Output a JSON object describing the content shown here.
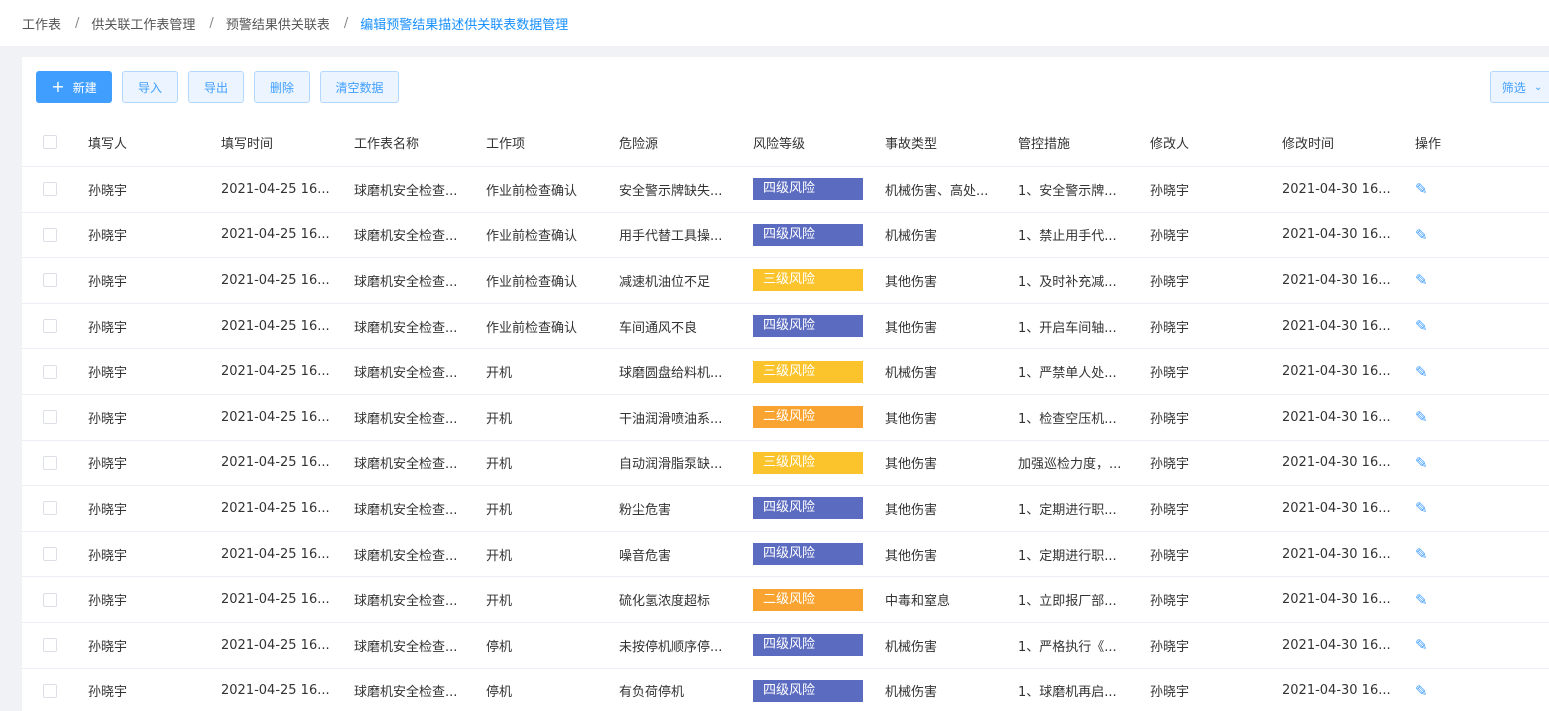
{
  "breadcrumb": [
    "工作表",
    "供关联工作表管理",
    "预警结果供关联表",
    "编辑预警结果描述供关联表数据管理"
  ],
  "toolbar": {
    "new_label": "新建",
    "import_label": "导入",
    "export_label": "导出",
    "delete_label": "删除",
    "clear_label": "清空数据",
    "filter_label": "筛选"
  },
  "columns": [
    "填写人",
    "填写时间",
    "工作表名称",
    "工作项",
    "危险源",
    "风险等级",
    "事故类型",
    "管控措施",
    "修改人",
    "修改时间",
    "操作"
  ],
  "risk_colors": {
    "四级风险": "#5b6bc0",
    "三级风险": "#fbc42d",
    "二级风险": "#f9a431"
  },
  "rows": [
    {
      "filler": "孙晓宇",
      "fill_time": "2021-04-25 16...",
      "sheet": "球磨机安全检查...",
      "item": "作业前检查确认",
      "hazard": "安全警示牌缺失...",
      "level": "四级风险",
      "type": "机械伤害、高处...",
      "control": "1、安全警示牌...",
      "modifier": "孙晓宇",
      "mod_time": "2021-04-30 16..."
    },
    {
      "filler": "孙晓宇",
      "fill_time": "2021-04-25 16...",
      "sheet": "球磨机安全检查...",
      "item": "作业前检查确认",
      "hazard": "用手代替工具操...",
      "level": "四级风险",
      "type": "机械伤害",
      "control": "1、禁止用手代...",
      "modifier": "孙晓宇",
      "mod_time": "2021-04-30 16..."
    },
    {
      "filler": "孙晓宇",
      "fill_time": "2021-04-25 16...",
      "sheet": "球磨机安全检查...",
      "item": "作业前检查确认",
      "hazard": "减速机油位不足",
      "level": "三级风险",
      "type": "其他伤害",
      "control": "1、及时补充减...",
      "modifier": "孙晓宇",
      "mod_time": "2021-04-30 16..."
    },
    {
      "filler": "孙晓宇",
      "fill_time": "2021-04-25 16...",
      "sheet": "球磨机安全检查...",
      "item": "作业前检查确认",
      "hazard": "车间通风不良",
      "level": "四级风险",
      "type": "其他伤害",
      "control": "1、开启车间轴...",
      "modifier": "孙晓宇",
      "mod_time": "2021-04-30 16..."
    },
    {
      "filler": "孙晓宇",
      "fill_time": "2021-04-25 16...",
      "sheet": "球磨机安全检查...",
      "item": "开机",
      "hazard": "球磨圆盘给料机...",
      "level": "三级风险",
      "type": "机械伤害",
      "control": "1、严禁单人处...",
      "modifier": "孙晓宇",
      "mod_time": "2021-04-30 16..."
    },
    {
      "filler": "孙晓宇",
      "fill_time": "2021-04-25 16...",
      "sheet": "球磨机安全检查...",
      "item": "开机",
      "hazard": "干油润滑喷油系...",
      "level": "二级风险",
      "type": "其他伤害",
      "control": "1、检查空压机...",
      "modifier": "孙晓宇",
      "mod_time": "2021-04-30 16..."
    },
    {
      "filler": "孙晓宇",
      "fill_time": "2021-04-25 16...",
      "sheet": "球磨机安全检查...",
      "item": "开机",
      "hazard": "自动润滑脂泵缺...",
      "level": "三级风险",
      "type": "其他伤害",
      "control": "加强巡检力度，...",
      "modifier": "孙晓宇",
      "mod_time": "2021-04-30 16..."
    },
    {
      "filler": "孙晓宇",
      "fill_time": "2021-04-25 16...",
      "sheet": "球磨机安全检查...",
      "item": "开机",
      "hazard": "粉尘危害",
      "level": "四级风险",
      "type": "其他伤害",
      "control": "1、定期进行职...",
      "modifier": "孙晓宇",
      "mod_time": "2021-04-30 16..."
    },
    {
      "filler": "孙晓宇",
      "fill_time": "2021-04-25 16...",
      "sheet": "球磨机安全检查...",
      "item": "开机",
      "hazard": "噪音危害",
      "level": "四级风险",
      "type": "其他伤害",
      "control": "1、定期进行职...",
      "modifier": "孙晓宇",
      "mod_time": "2021-04-30 16..."
    },
    {
      "filler": "孙晓宇",
      "fill_time": "2021-04-25 16...",
      "sheet": "球磨机安全检查...",
      "item": "开机",
      "hazard": "硫化氢浓度超标",
      "level": "二级风险",
      "type": "中毒和窒息",
      "control": "1、立即报厂部...",
      "modifier": "孙晓宇",
      "mod_time": "2021-04-30 16..."
    },
    {
      "filler": "孙晓宇",
      "fill_time": "2021-04-25 16...",
      "sheet": "球磨机安全检查...",
      "item": "停机",
      "hazard": "未按停机顺序停...",
      "level": "四级风险",
      "type": "机械伤害",
      "control": "1、严格执行《...",
      "modifier": "孙晓宇",
      "mod_time": "2021-04-30 16..."
    },
    {
      "filler": "孙晓宇",
      "fill_time": "2021-04-25 16...",
      "sheet": "球磨机安全检查...",
      "item": "停机",
      "hazard": "有负荷停机",
      "level": "四级风险",
      "type": "机械伤害",
      "control": "1、球磨机再启...",
      "modifier": "孙晓宇",
      "mod_time": "2021-04-30 16..."
    }
  ]
}
